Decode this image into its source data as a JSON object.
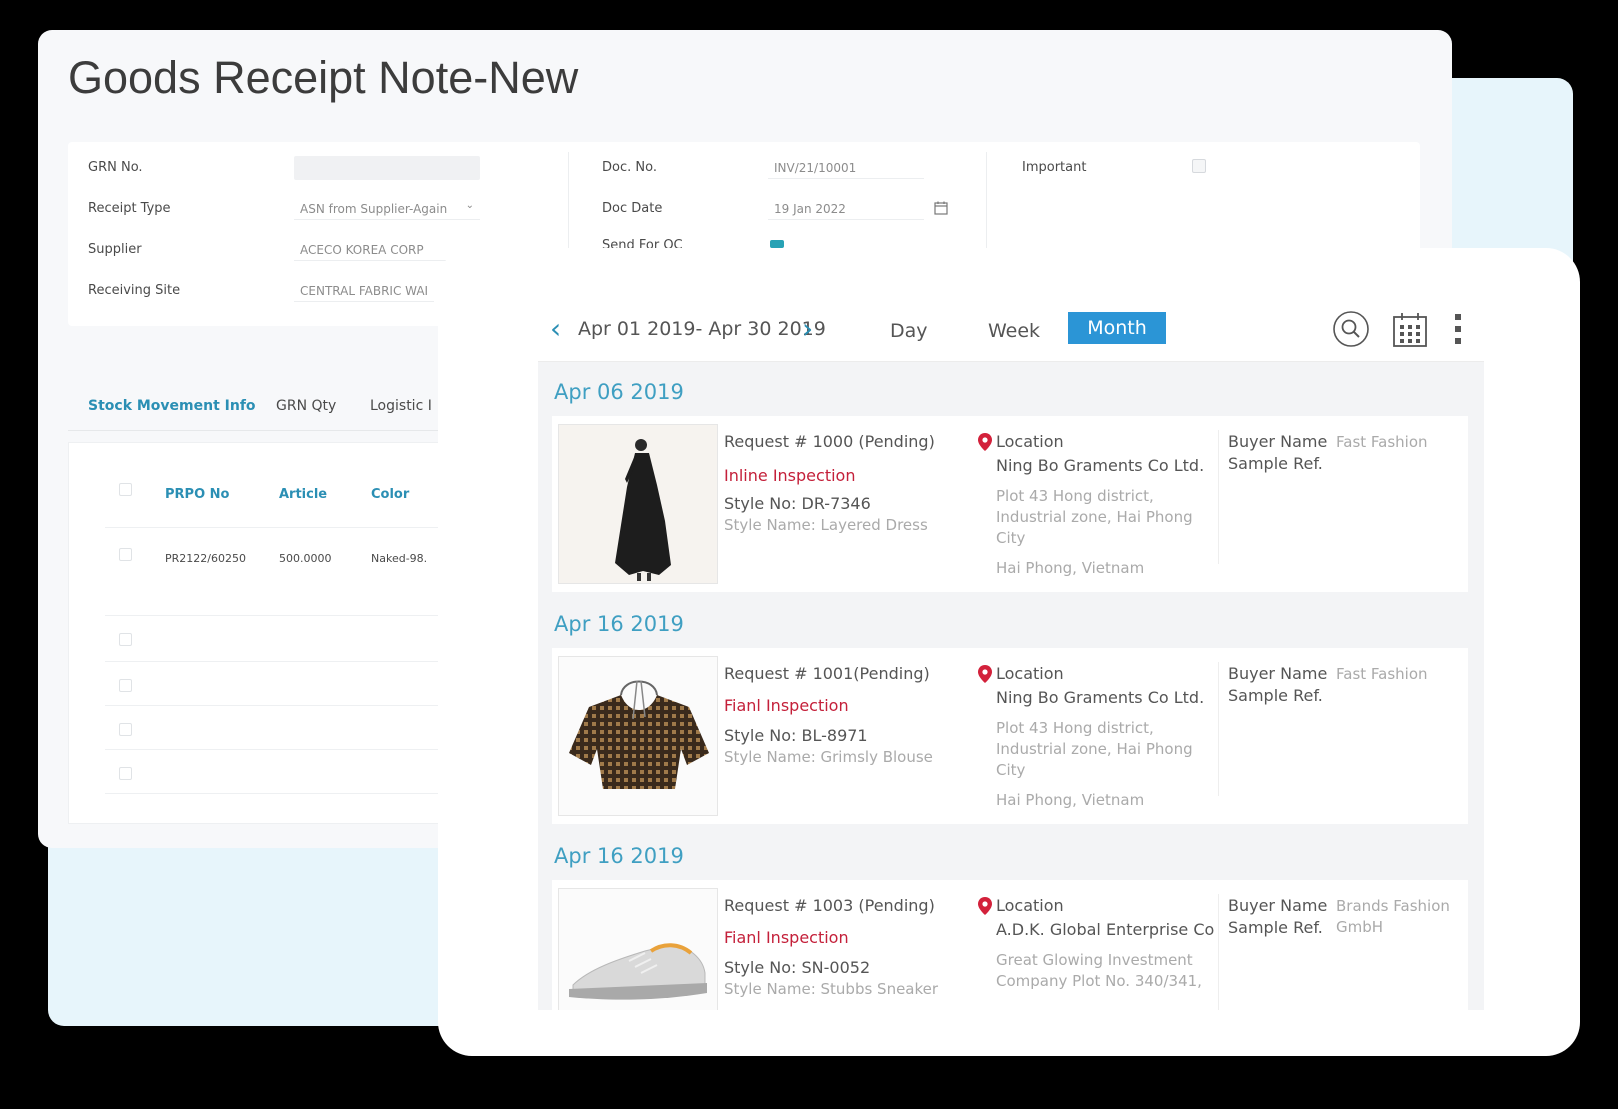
{
  "grn": {
    "title": "Goods Receipt Note-New",
    "form": {
      "grn_no_label": "GRN No.",
      "receipt_type_label": "Receipt Type",
      "receipt_type_value": "ASN from Supplier-Again",
      "supplier_label": "Supplier",
      "supplier_value": "ACECO KOREA CORP",
      "receiving_site_label": "Receiving Site",
      "receiving_site_value": "CENTRAL FABRIC WAI",
      "doc_no_label": "Doc. No.",
      "doc_no_value": "INV/21/10001",
      "doc_date_label": "Doc Date",
      "doc_date_value": "19 Jan 2022",
      "send_for_qc_label": "Send For QC",
      "important_label": "Important"
    },
    "tabs": [
      "Stock Movement Info",
      "GRN Qty",
      "Logistic I"
    ],
    "table": {
      "columns": [
        "PRPO No",
        "Article",
        "Color"
      ],
      "rows": [
        {
          "prpo_no": "PR2122/60250",
          "article": "500.0000",
          "color": "Naked-98."
        }
      ]
    }
  },
  "calendar": {
    "range": "Apr 01 2019- Apr 30 2019",
    "views": [
      "Day",
      "Week",
      "Month"
    ],
    "active_view": "Month",
    "icons": [
      "search-icon",
      "calendar-grid-icon",
      "more-vertical-icon"
    ],
    "groups": [
      {
        "date": "Apr 06 2019",
        "request": "Request # 1000 (Pending)",
        "inspection_type": "Inline Inspection",
        "style_no": "Style No: DR-7346",
        "style_name": "Style Name: Layered Dress",
        "location_label": "Location",
        "company": "Ning Bo Graments Co Ltd.",
        "address": "Plot 43 Hong district, Industrial zone, Hai Phong City",
        "city": "Hai Phong, Vietnam",
        "buyer_label": "Buyer Name",
        "buyer_value": "Fast Fashion",
        "sample_label": "Sample Ref."
      },
      {
        "date": "Apr 16 2019",
        "request": "Request # 1001(Pending)",
        "inspection_type": "Fianl Inspection",
        "style_no": "Style No: BL-8971",
        "style_name": "Style Name: Grimsly Blouse",
        "location_label": "Location",
        "company": "Ning Bo Graments Co Ltd.",
        "address": "Plot 43 Hong district, Industrial zone, Hai Phong City",
        "city": "Hai Phong, Vietnam",
        "buyer_label": "Buyer Name",
        "buyer_value": "Fast Fashion",
        "sample_label": "Sample Ref."
      },
      {
        "date": "Apr 16 2019",
        "request": "Request # 1003 (Pending)",
        "inspection_type": "Fianl Inspection",
        "style_no": "Style No: SN-0052",
        "style_name": "Style Name: Stubbs Sneaker",
        "location_label": "Location",
        "company": "A.D.K. Global Enterprise Co...",
        "address": "Great Glowing Investment Company Plot No. 340/341,",
        "city": "",
        "buyer_label": "Buyer Name",
        "buyer_value": "Brands Fashion GmbH",
        "sample_label": "Sample Ref."
      }
    ]
  },
  "colors": {
    "accent_teal": "#2b8fb4",
    "active_view_bg": "#2b95d6",
    "inspection_red": "#c4203a"
  }
}
